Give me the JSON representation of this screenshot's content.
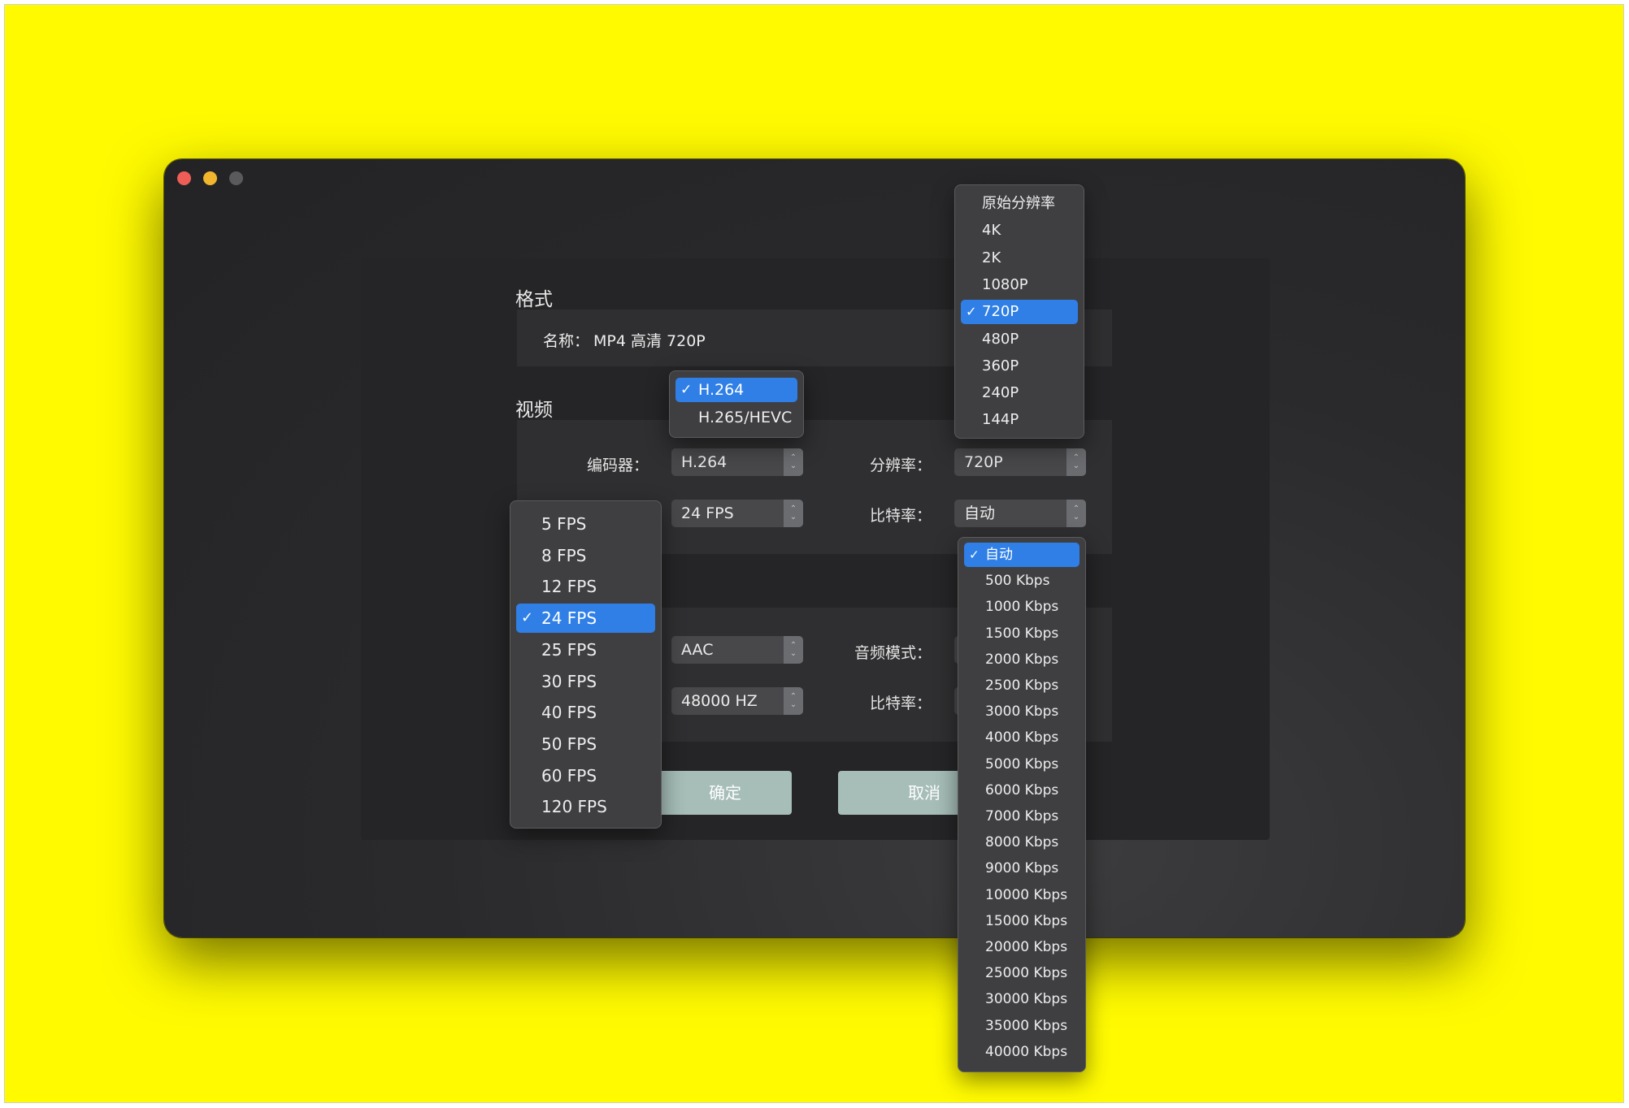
{
  "format": {
    "title": "格式",
    "name_label": "名称：",
    "name_value": "MP4 高清 720P"
  },
  "video": {
    "title": "视频",
    "codec_label": "编码器：",
    "codec_value": "H.264",
    "fps_value": "24 FPS",
    "resolution_label": "分辨率：",
    "resolution_value": "720P",
    "bitrate_label": "比特率：",
    "bitrate_value": "自动"
  },
  "audio": {
    "codec_value": "AAC",
    "samplerate_value": "48000 HZ",
    "mode_label": "音频模式：",
    "bitrate_label": "比特率："
  },
  "buttons": {
    "confirm": "确定",
    "cancel": "取消"
  },
  "menus": {
    "codec": {
      "items": [
        "H.264",
        "H.265/HEVC"
      ],
      "selected": "H.264"
    },
    "resolution": {
      "items": [
        "原始分辨率",
        "4K",
        "2K",
        "1080P",
        "720P",
        "480P",
        "360P",
        "240P",
        "144P"
      ],
      "selected": "720P"
    },
    "fps": {
      "items": [
        "5 FPS",
        "8 FPS",
        "12 FPS",
        "24 FPS",
        "25 FPS",
        "30 FPS",
        "40 FPS",
        "50 FPS",
        "60 FPS",
        "120 FPS"
      ],
      "selected": "24 FPS"
    },
    "bitrate": {
      "items": [
        "自动",
        "500 Kbps",
        "1000 Kbps",
        "1500 Kbps",
        "2000 Kbps",
        "2500 Kbps",
        "3000 Kbps",
        "4000 Kbps",
        "5000 Kbps",
        "6000 Kbps",
        "7000 Kbps",
        "8000 Kbps",
        "9000 Kbps",
        "10000 Kbps",
        "15000 Kbps",
        "20000 Kbps",
        "25000 Kbps",
        "30000 Kbps",
        "35000 Kbps",
        "40000 Kbps"
      ],
      "selected": "自动"
    }
  },
  "icons": {
    "check": "check-icon",
    "stepper": "up-down-chevron-icon"
  },
  "colors": {
    "background": "#FFFA00",
    "selection": "#2F7FE6",
    "button": "#A6BDB8"
  }
}
